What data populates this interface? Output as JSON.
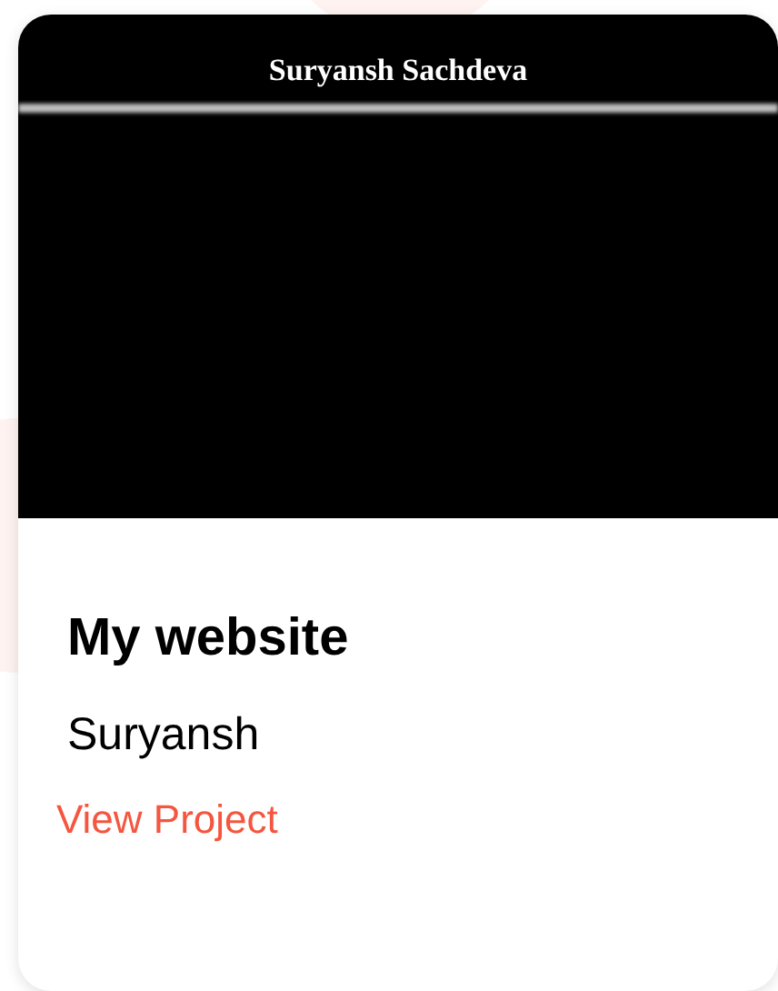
{
  "card": {
    "preview": {
      "site_title": "Suryansh Sachdeva"
    },
    "title": "My website",
    "author": "Suryansh",
    "link": "View Project"
  }
}
